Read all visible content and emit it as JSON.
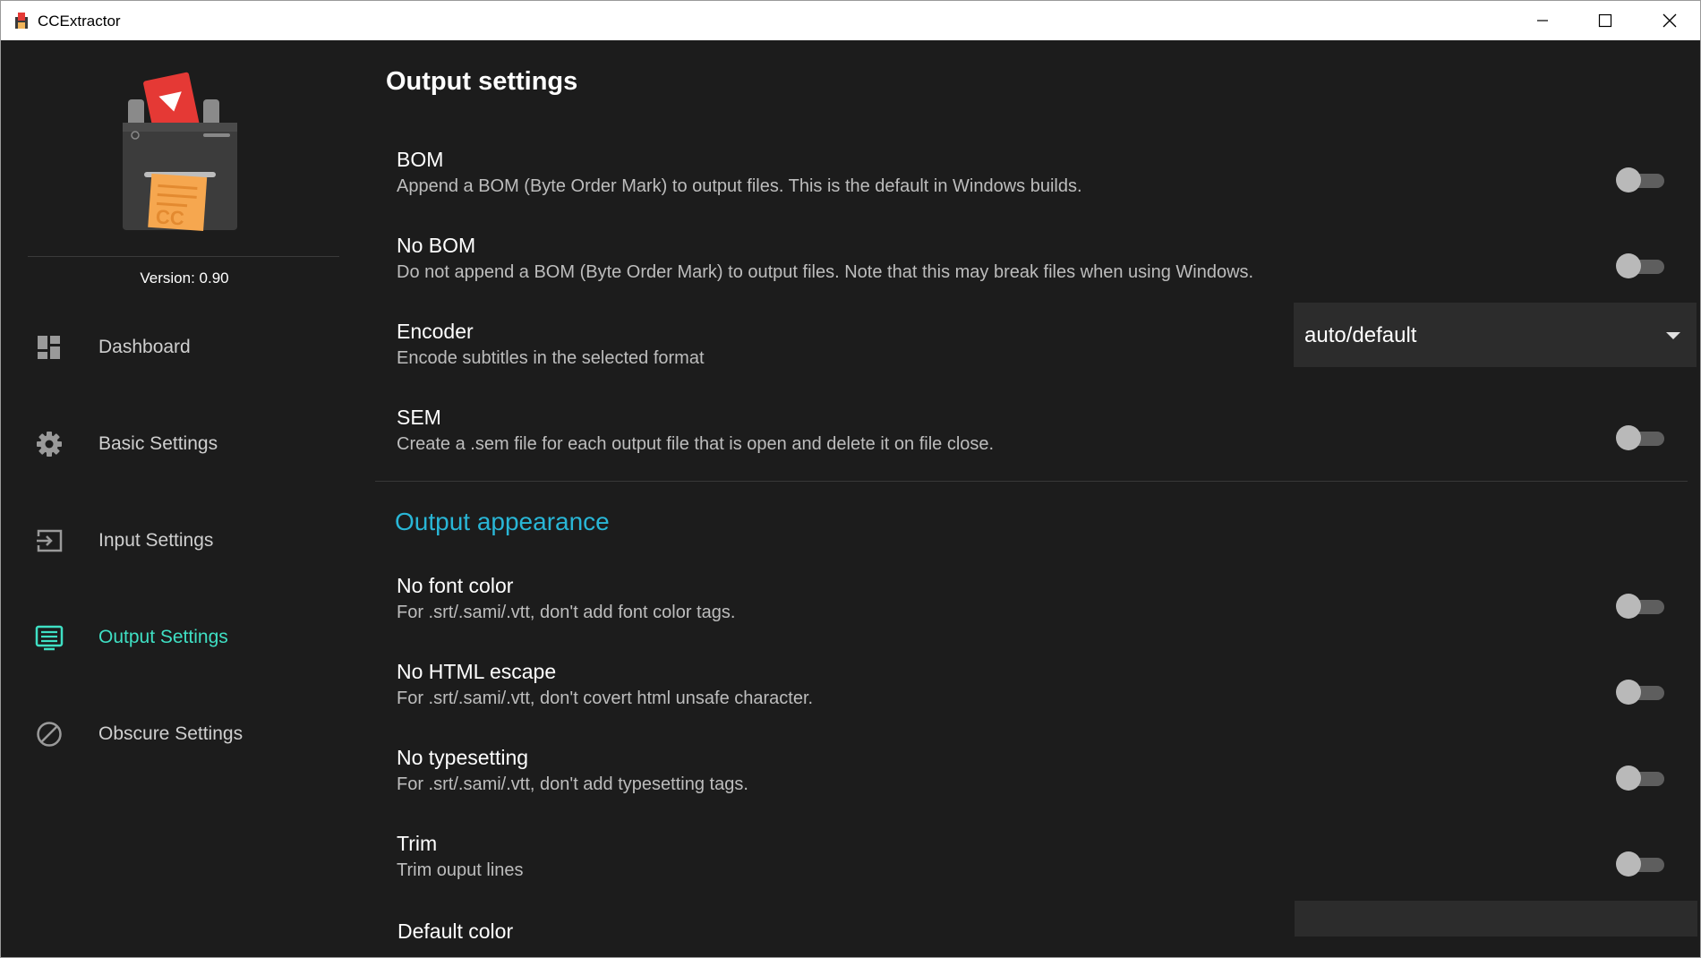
{
  "window": {
    "title": "CCExtractor",
    "controls": [
      "minimize-icon",
      "maximize-icon",
      "close-icon"
    ]
  },
  "sidebar": {
    "version_label": "Version: 0.90",
    "items": [
      {
        "label": "Dashboard",
        "icon": "dashboard-icon",
        "active": false
      },
      {
        "label": "Basic Settings",
        "icon": "gear-icon",
        "active": false
      },
      {
        "label": "Input Settings",
        "icon": "input-icon",
        "active": false
      },
      {
        "label": "Output Settings",
        "icon": "output-icon",
        "active": true
      },
      {
        "label": "Obscure Settings",
        "icon": "block-icon",
        "active": false
      }
    ]
  },
  "main": {
    "title": "Output settings",
    "settings": [
      {
        "title": "BOM",
        "description": "Append a BOM (Byte Order Mark) to output files. This is the default in Windows builds.",
        "enabled": false
      },
      {
        "title": "No BOM",
        "description": "Do not append a BOM (Byte Order Mark) to output files. Note that this may break files when using Windows.",
        "enabled": false
      },
      {
        "title": "Encoder",
        "description": "Encode subtitles in the selected format",
        "selected": "auto/default"
      },
      {
        "title": "SEM",
        "description": "Create a .sem file for each output file that is open and delete it on file close.",
        "enabled": false
      }
    ],
    "appearance": {
      "heading": "Output appearance",
      "settings": [
        {
          "title": "No font color",
          "description": "For .srt/.sami/.vtt, don't add font color tags.",
          "enabled": false
        },
        {
          "title": "No HTML escape",
          "description": "For .srt/.sami/.vtt, don't covert html unsafe character.",
          "enabled": false
        },
        {
          "title": "No typesetting",
          "description": "For .srt/.sami/.vtt, don't add typesetting tags.",
          "enabled": false
        },
        {
          "title": "Trim",
          "description": "Trim ouput lines",
          "enabled": false
        },
        {
          "title": "Default color",
          "value": ""
        }
      ]
    }
  },
  "colors": {
    "background": "#1c1c1c",
    "accent_active": "#3fe0c4",
    "section_heading": "#29b6d6",
    "toggle_off_track": "#5e5e5e",
    "toggle_off_knob": "#b9b9b9"
  }
}
